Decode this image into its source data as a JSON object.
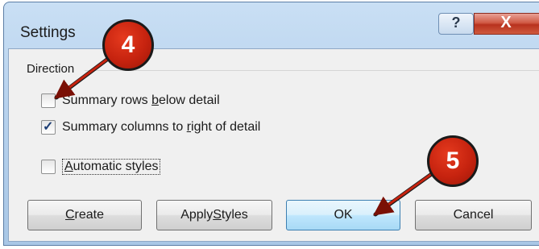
{
  "dialog": {
    "title": "Settings",
    "help_glyph": "?",
    "close_glyph": "X"
  },
  "direction_group": {
    "label": "Direction"
  },
  "options": {
    "summary_rows": {
      "pre": "Summary rows ",
      "accel": "b",
      "post": "elow detail",
      "checked": false
    },
    "summary_columns": {
      "pre": "Summary columns to ",
      "accel": "r",
      "post": "ight of detail",
      "checked": true
    },
    "automatic_styles": {
      "pre": "",
      "accel": "A",
      "post": "utomatic styles",
      "checked": false
    }
  },
  "buttons": {
    "create": {
      "pre": "",
      "accel": "C",
      "post": "reate"
    },
    "apply_styles": {
      "pre": "Apply ",
      "accel": "S",
      "post": "tyles"
    },
    "ok": {
      "label": "OK"
    },
    "cancel": {
      "label": "Cancel"
    }
  },
  "callouts": {
    "step_4": "4",
    "step_5": "5"
  },
  "check_glyph": "✓",
  "colors": {
    "callout_fill": "#c6230f",
    "default_button_border": "#3c7fb1",
    "close_button": "#c0392b"
  }
}
